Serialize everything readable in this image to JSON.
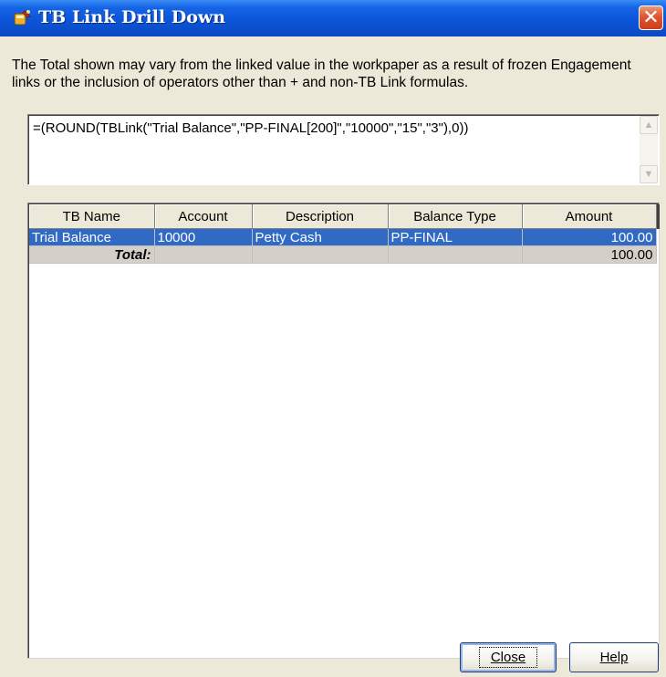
{
  "window": {
    "title": "TB Link Drill Down",
    "close_symbol": "✕"
  },
  "message": "The Total shown may vary from the linked value in the workpaper as a result of frozen Engagement links or the inclusion of operators other than + and non-TB Link formulas.",
  "formula": "=(ROUND(TBLink(\"Trial Balance\",\"PP-FINAL[200]\",\"10000\",\"15\",\"3\"),0))",
  "scroll": {
    "up_symbol": "▲",
    "down_symbol": "▼"
  },
  "grid": {
    "columns": [
      "TB Name",
      "Account",
      "Description",
      "Balance Type",
      "Amount"
    ],
    "rows": [
      {
        "tb_name": "Trial Balance",
        "account": "10000",
        "description": "Petty Cash",
        "balance_type": "PP-FINAL",
        "amount": "100.00",
        "selected": true
      }
    ],
    "total": {
      "label": "Total:",
      "amount": "100.00"
    }
  },
  "buttons": {
    "close_label": "Close",
    "help_label": "Help"
  },
  "colors": {
    "titlebar": "#0b53d6",
    "selection": "#316ac5",
    "close_button": "#e0562e",
    "dialog_face": "#ece9d8"
  },
  "icons": {
    "title": "tb-link-wand-icon",
    "close": "close-icon"
  }
}
